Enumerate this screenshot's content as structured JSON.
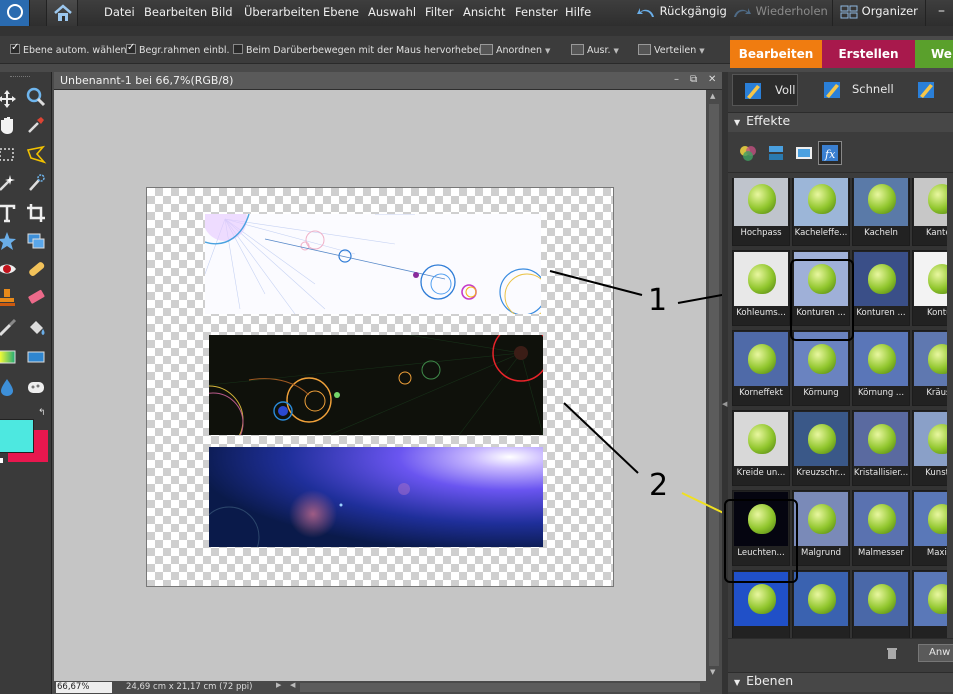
{
  "menubar": {
    "items": [
      "Datei",
      "Bearbeiten",
      "Bild",
      "Überarbeiten",
      "Ebene",
      "Auswahl",
      "Filter",
      "Ansicht",
      "Fenster",
      "Hilfe"
    ],
    "undo": "Rückgängig",
    "redo": "Wiederholen",
    "organizer": "Organizer"
  },
  "options": {
    "auto_select": "Ebene autom. wählen",
    "bounding_box": "Begr.rahmen einbl.",
    "hover_highlight": "Beim Darüberbewegen mit der Maus hervorheben",
    "arrange": "Anordnen",
    "align": "Ausr.",
    "distribute": "Verteilen"
  },
  "tabs": {
    "edit": "Bearbeiten",
    "create": "Erstellen",
    "share": "Wei"
  },
  "document": {
    "title": "Unbenannt-1 bei 66,7%(RGB/8)",
    "zoom": "66,67%",
    "size": "24,69 cm x 21,17 cm (72 ppi)"
  },
  "panel": {
    "mode_full": "Voll",
    "mode_quick": "Schnell",
    "effects_header": "Effekte",
    "layers_header": "Ebenen",
    "apply_button": "Anw",
    "thumbnails": [
      [
        "Hochpass",
        "Kacheleffe...",
        "Kacheln",
        "Kanten"
      ],
      [
        "Kohleums...",
        "Konturen ...",
        "Konturen ...",
        "Kontur"
      ],
      [
        "Korneffekt",
        "Körnung",
        "Körnung ...",
        "Kräuse"
      ],
      [
        "Kreide un...",
        "Kreuzschr...",
        "Kristallisier...",
        "Kunstst"
      ],
      [
        "Leuchten...",
        "Malgrund",
        "Malmesser",
        "Maxim"
      ],
      [
        "",
        "",
        "",
        ""
      ]
    ]
  },
  "annotations": {
    "label_1": "1",
    "label_2": "2"
  },
  "colors": {
    "foreground": "#4de8e0",
    "background": "#e8174e",
    "tab_edit": "#f07c10",
    "tab_create": "#a8194c",
    "tab_share": "#5aa02c"
  }
}
